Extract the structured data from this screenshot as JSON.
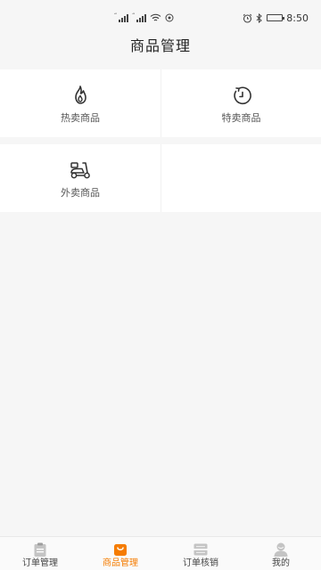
{
  "status_bar": {
    "signal_tag": "4G",
    "time": "8:50",
    "icons": [
      "signal-icon",
      "signal-icon",
      "wifi-icon",
      "location-icon",
      "alarm-icon",
      "bluetooth-icon",
      "battery-icon"
    ]
  },
  "page": {
    "title": "商品管理"
  },
  "menu": {
    "items": [
      {
        "label": "热卖商品",
        "icon": "flame-icon"
      },
      {
        "label": "特卖商品",
        "icon": "timer-icon"
      },
      {
        "label": "外卖商品",
        "icon": "scooter-icon"
      }
    ]
  },
  "tabbar": {
    "tabs": [
      {
        "label": "订单管理",
        "icon": "clipboard-icon"
      },
      {
        "label": "商品管理",
        "icon": "shopping-bag-icon",
        "active": true
      },
      {
        "label": "订单核销",
        "icon": "scanner-icon"
      },
      {
        "label": "我的",
        "icon": "user-icon"
      }
    ]
  },
  "colors": {
    "accent": "#f57c00",
    "background": "#f6f6f6",
    "card": "#ffffff",
    "icon_inactive": "#c4c4c4"
  }
}
